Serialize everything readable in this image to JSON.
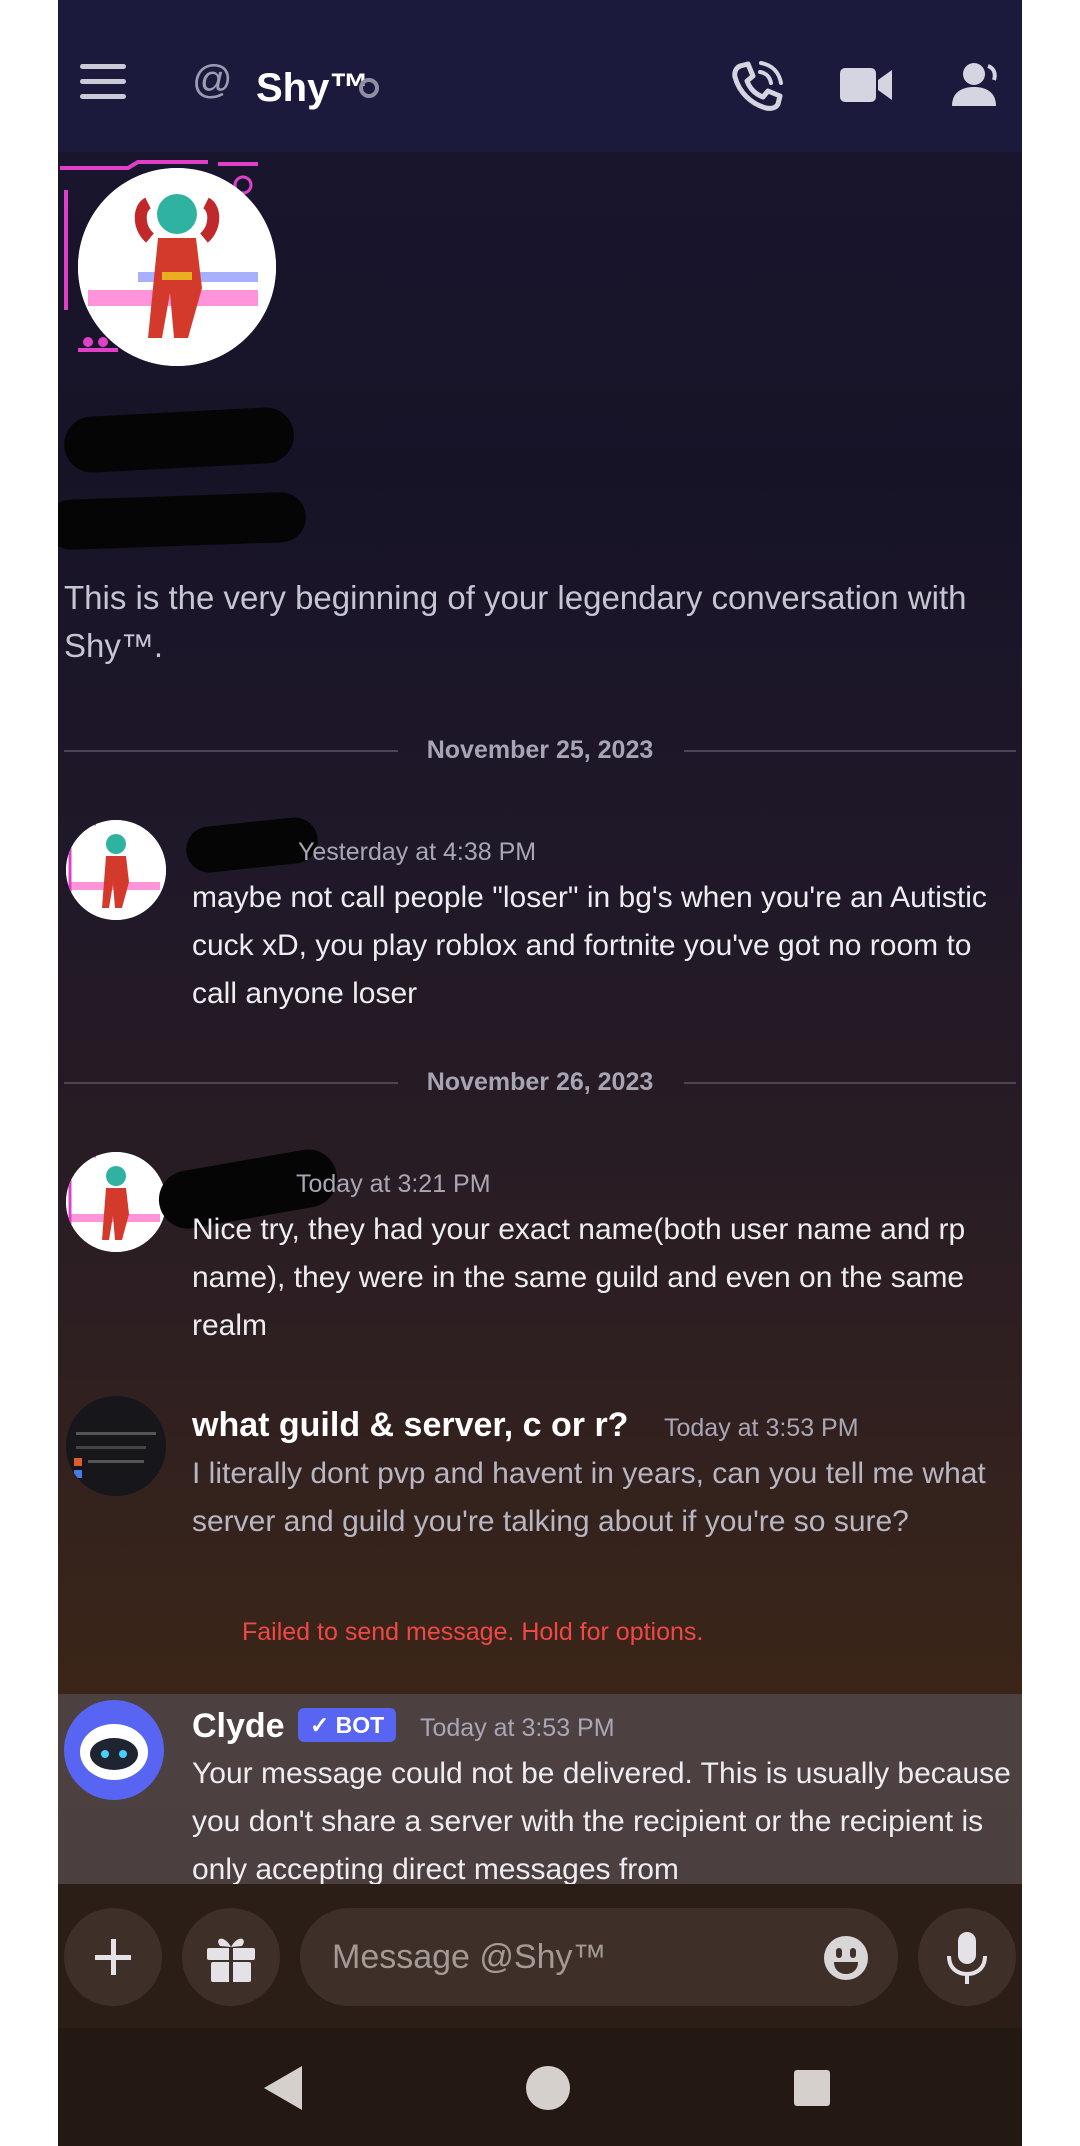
{
  "header": {
    "title": "Shy™",
    "at_symbol": "@",
    "icons": [
      "menu-icon",
      "at-icon",
      "call-icon",
      "video-icon",
      "members-icon"
    ]
  },
  "intro": {
    "text": "This is the very beginning of your legendary conversation with Shy™."
  },
  "dividers": [
    "November 25, 2023",
    "November 26, 2023"
  ],
  "messages": [
    {
      "time": "Yesterday at 4:38 PM",
      "body": "maybe not call people \"loser\" in bg's when you're an Autistic cuck xD, you play roblox and fortnite you've got no room to call anyone loser"
    },
    {
      "time": "Today at 3:21 PM",
      "body": "Nice try, they had your exact name(both user name and rp name), they were in the same guild and even on the same realm"
    },
    {
      "author": "what guild & server, c or r?",
      "time": "Today at 3:53 PM",
      "body": "I literally dont pvp and havent in years, can you tell me what server and guild you're talking about if you're so sure?",
      "status": "Failed to send message. Hold for options."
    },
    {
      "author": "Clyde",
      "badge": "BOT",
      "time": "Today at 3:53 PM",
      "body": "Your message could not be delivered. This is usually because you don't share a server with the recipient or the recipient is only accepting direct messages from"
    }
  ],
  "composer": {
    "placeholder": "Message @Shy™"
  },
  "colors": {
    "header_bg": "#1c1a3c",
    "error": "#f04747",
    "bot_badge": "#5865f2"
  }
}
